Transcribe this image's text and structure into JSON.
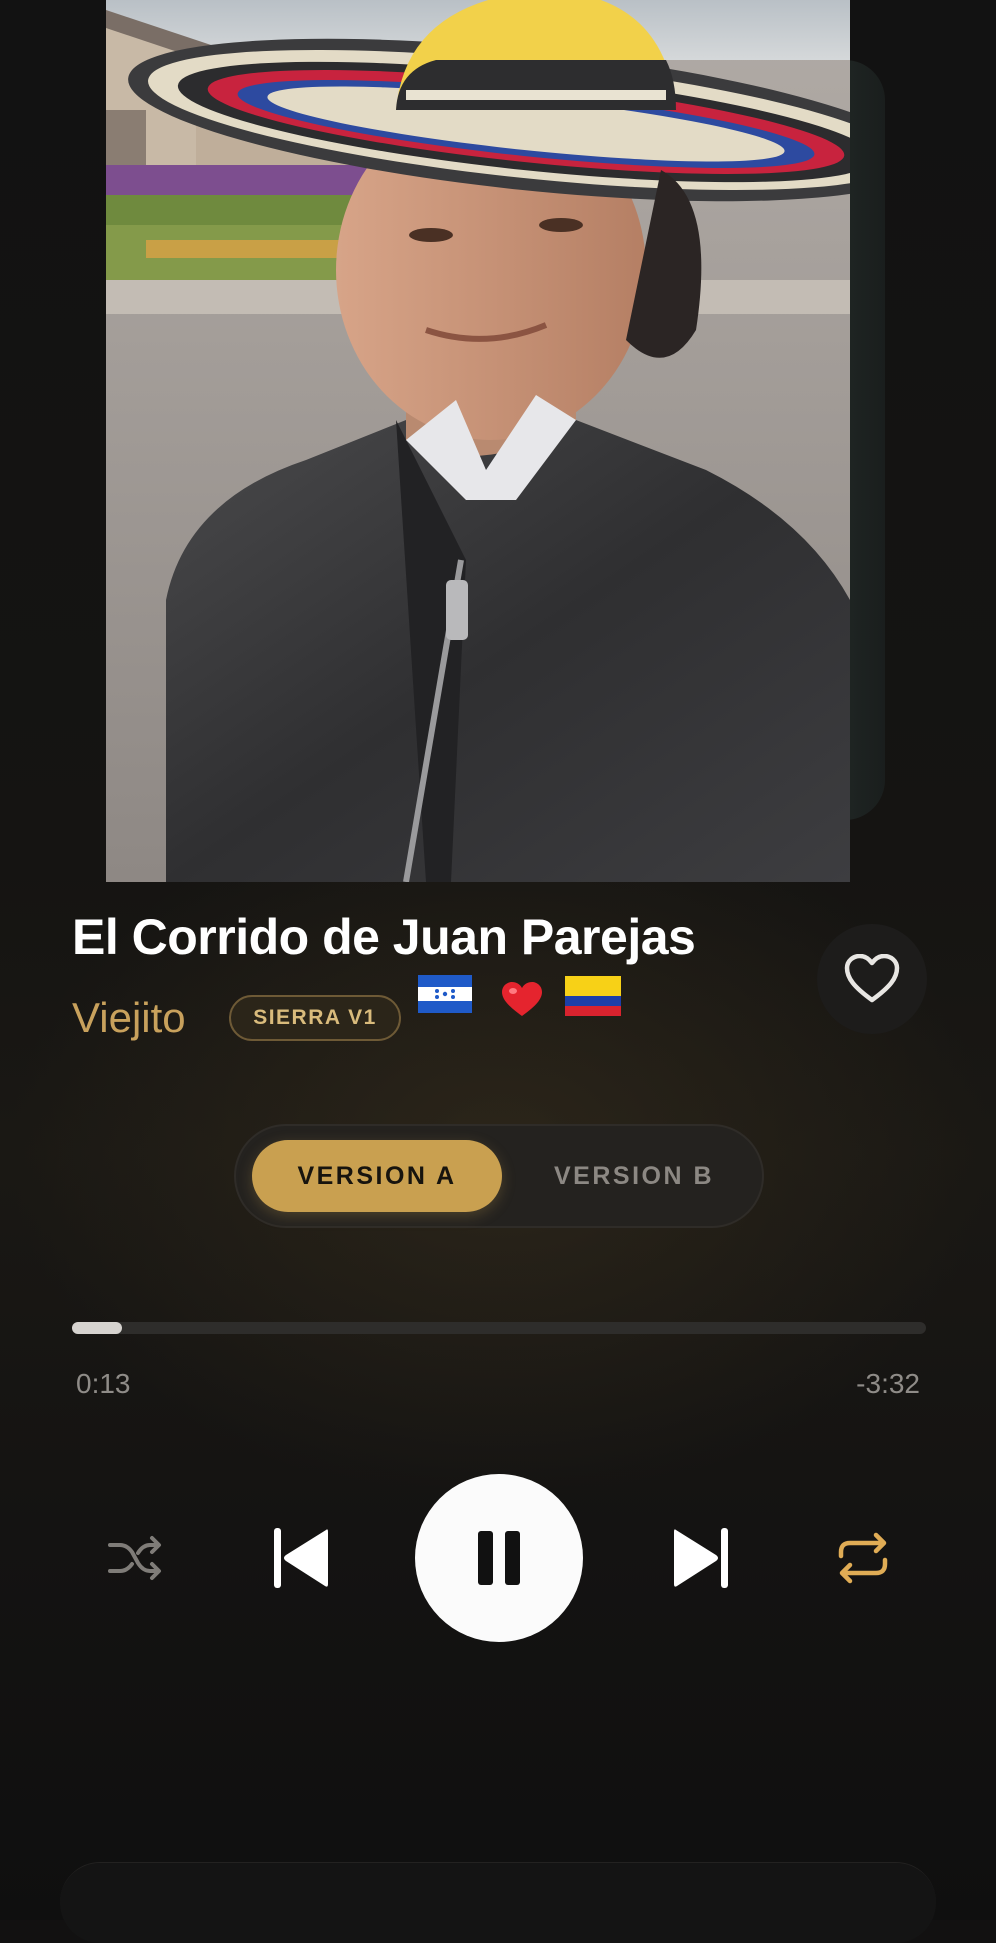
{
  "track": {
    "title": "El Corrido de Juan Parejas",
    "artist": "Viejito",
    "badge": "SIERRA V1",
    "emojis": [
      "🇭🇳",
      "❤️",
      "🇨🇴"
    ]
  },
  "version_toggle": {
    "options": [
      "VERSION A",
      "VERSION B"
    ],
    "selected": "VERSION A"
  },
  "playback": {
    "elapsed": "0:13",
    "remaining": "-3:32",
    "progress_fraction": 0.058,
    "state": "playing"
  },
  "icons": {
    "like": "heart-outline-icon",
    "shuffle": "shuffle-icon",
    "previous": "skip-previous-icon",
    "play_pause": "pause-icon",
    "next": "skip-next-icon",
    "repeat": "repeat-icon"
  },
  "colors": {
    "accent_gold": "#c9a050",
    "artist_gold": "#c8a15c",
    "background": "#121111",
    "repeat_active": "#e0ac55"
  }
}
